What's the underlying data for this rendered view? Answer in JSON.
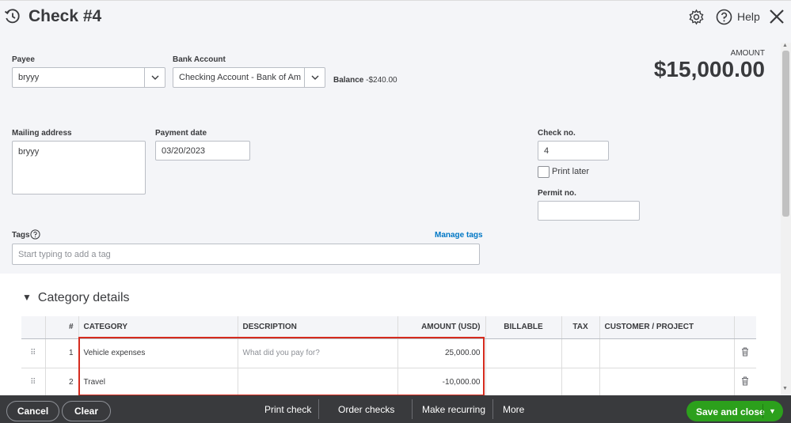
{
  "header": {
    "title": "Check #4",
    "help_label": "Help",
    "icons": [
      "history-icon",
      "gear-icon",
      "help-icon",
      "close-icon"
    ]
  },
  "form": {
    "payee": {
      "label": "Payee",
      "value": "bryyy"
    },
    "bank_account": {
      "label": "Bank Account",
      "value": "Checking Account - Bank of Amer"
    },
    "balance": {
      "label": "Balance",
      "value": "-$240.00"
    },
    "amount": {
      "label": "AMOUNT",
      "value": "$15,000.00"
    },
    "mailing_address": {
      "label": "Mailing address",
      "value": "bryyy"
    },
    "payment_date": {
      "label": "Payment date",
      "value": "03/20/2023"
    },
    "check_no": {
      "label": "Check no.",
      "value": "4"
    },
    "print_later": {
      "label": "Print later",
      "checked": false
    },
    "permit_no": {
      "label": "Permit no.",
      "value": ""
    },
    "tags": {
      "label": "Tags",
      "placeholder": "Start typing to add a tag",
      "manage_label": "Manage tags"
    }
  },
  "category_details": {
    "title": "Category details",
    "columns": [
      "#",
      "CATEGORY",
      "DESCRIPTION",
      "AMOUNT (USD)",
      "BILLABLE",
      "TAX",
      "CUSTOMER / PROJECT"
    ],
    "rows": [
      {
        "num": "1",
        "category": "Vehicle expenses",
        "description_placeholder": "What did you pay for?",
        "amount": "25,000.00"
      },
      {
        "num": "2",
        "category": "Travel",
        "description_placeholder": "",
        "amount": "-10,000.00"
      }
    ]
  },
  "footer": {
    "cancel": "Cancel",
    "clear": "Clear",
    "print_check": "Print check",
    "order_checks": "Order checks",
    "make_recurring": "Make recurring",
    "more": "More",
    "save_and_close": "Save and close"
  },
  "colors": {
    "accent_green": "#2ca01c",
    "link_blue": "#0077c5",
    "footer_bg": "#393a3d",
    "highlight_red": "#d52b1e"
  }
}
